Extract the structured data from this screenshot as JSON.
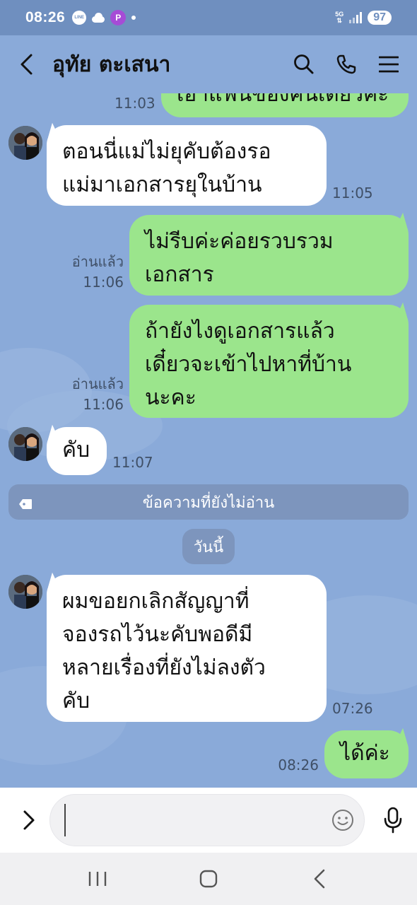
{
  "status_bar": {
    "time": "08:26",
    "notification_icons": [
      "line-icon",
      "cloud-icon",
      "p-app-icon",
      "dot-icon"
    ],
    "network": "5G",
    "battery": "97"
  },
  "header": {
    "contact_name": "อุทัย ตะเสนา",
    "icons": [
      "back-icon",
      "search-icon",
      "phone-icon",
      "menu-icon"
    ]
  },
  "messages": [
    {
      "from": "me",
      "text": "เอาแฟ้นของคนเดียวค่ะ",
      "time": "11:03"
    },
    {
      "from": "them",
      "text": "ตอนนี่แม่ไม่ยุคับต้องรอ\nแม่มาเอกสารยุในบ้าน",
      "time": "11:05"
    },
    {
      "from": "me",
      "text": "ไม่รีบค่ะค่อยรวบรวม\nเอกสาร",
      "read": "อ่านแล้ว",
      "time": "11:06"
    },
    {
      "from": "me",
      "text": "ถ้ายังไงดูเอกสารแล้ว\nเดี๋ยวจะเข้าไปหาที่บ้าน\nนะคะ",
      "read": "อ่านแล้ว",
      "time": "11:06"
    },
    {
      "from": "them",
      "text": "คับ",
      "time": "11:07"
    },
    {
      "from": "them",
      "text": "ผมขอยกเลิกสัญญาที่\nจองรถไว้นะคับพอดีมี\nหลายเรื่องที่ยังไม่ลงตัว\nคับ",
      "time": "07:26"
    },
    {
      "from": "me",
      "text": "ได้ค่ะ",
      "time": "08:26"
    }
  ],
  "unread_divider": "ข้อความที่ยังไม่อ่าน",
  "date_divider": "วันนี้",
  "input": {
    "value": "",
    "placeholder": ""
  },
  "colors": {
    "background": "#8aaad9",
    "status_bar": "#6f8fbf",
    "outgoing_bubble": "#9be58c",
    "incoming_bubble": "#ffffff",
    "divider_pill": "#7d95bd"
  }
}
